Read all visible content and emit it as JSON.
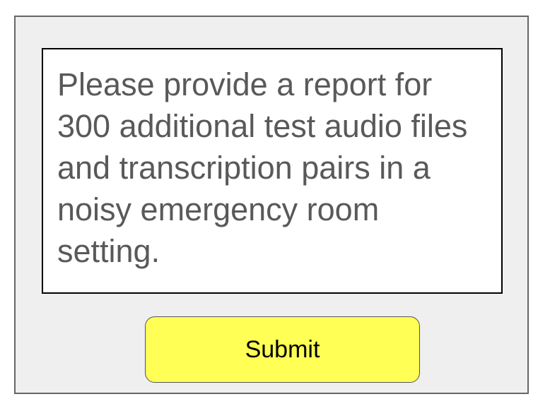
{
  "prompt": {
    "text": "Please provide a report for 300 additional test audio files and transcription pairs in a noisy emergency room setting."
  },
  "actions": {
    "submit_label": "Submit"
  },
  "colors": {
    "panel_background": "#efefef",
    "button_background": "#ffff55",
    "prompt_text": "#595959"
  }
}
